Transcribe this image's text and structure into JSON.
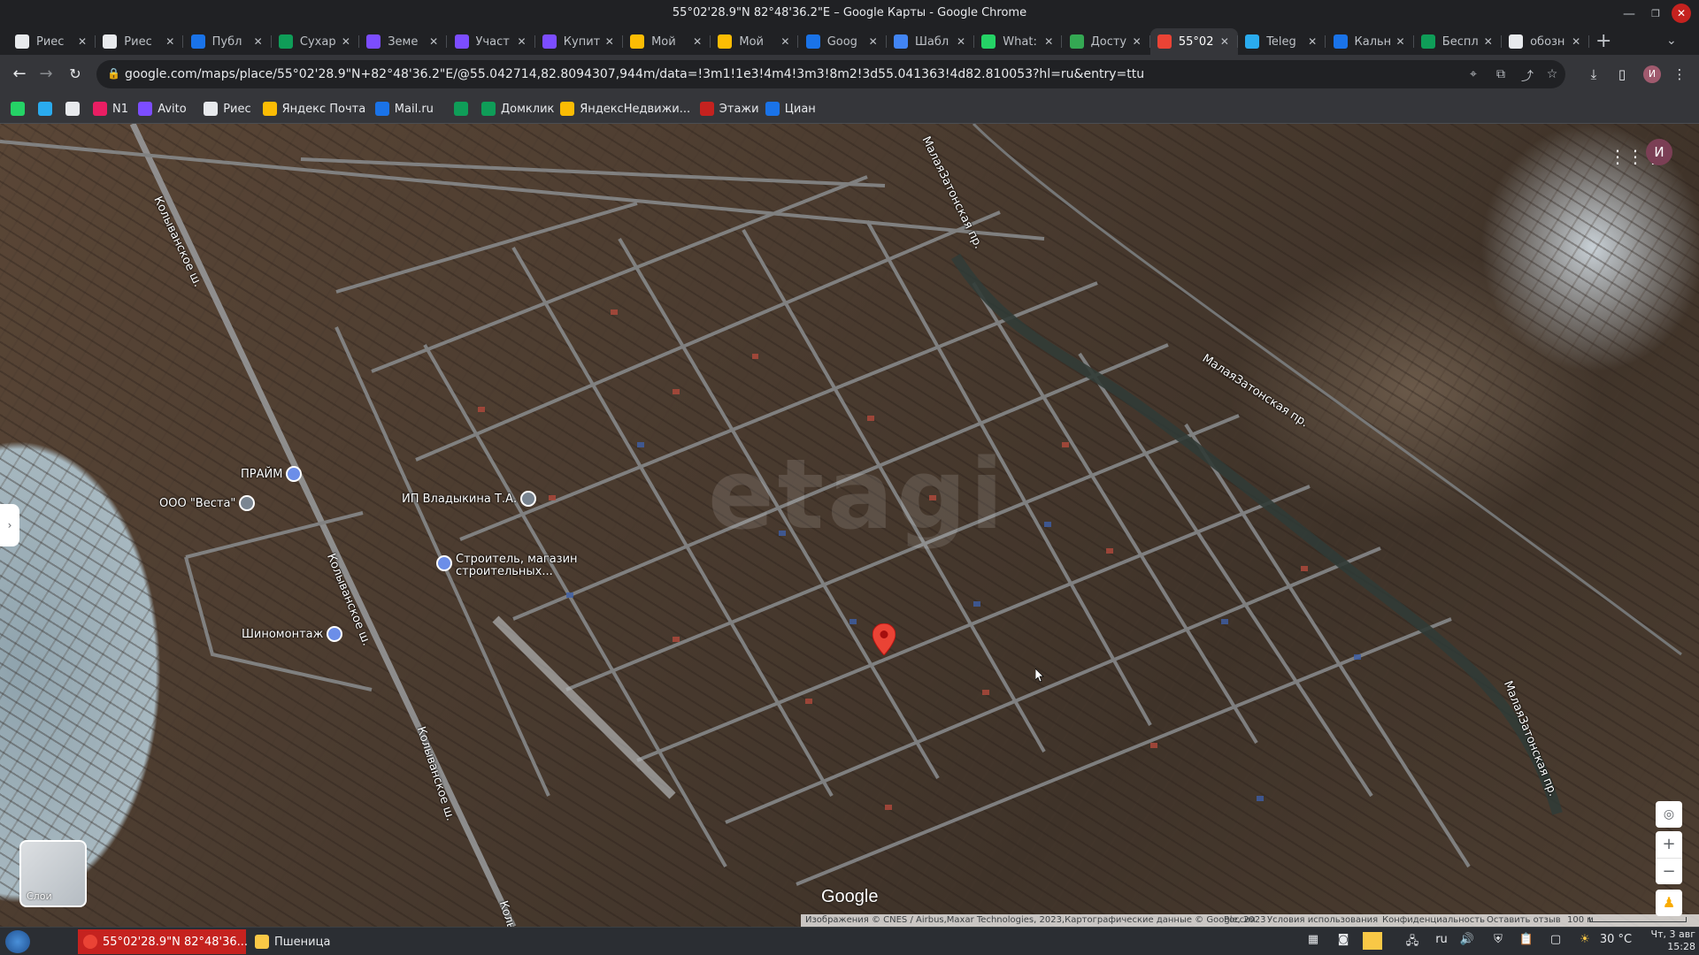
{
  "window": {
    "title": "55°02'28.9\"N 82°48'36.2\"E – Google Карты - Google Chrome"
  },
  "tabs": [
    {
      "label": "Риес",
      "favicon_color": "#e8eaed"
    },
    {
      "label": "Риес",
      "favicon_color": "#e8eaed"
    },
    {
      "label": "Публ",
      "favicon_color": "#1a73e8"
    },
    {
      "label": "Сухар",
      "favicon_color": "#0f9d58"
    },
    {
      "label": "Земе",
      "favicon_color": "#7c4dff"
    },
    {
      "label": "Участ",
      "favicon_color": "#7c4dff"
    },
    {
      "label": "Купит",
      "favicon_color": "#7c4dff"
    },
    {
      "label": "Мой",
      "favicon_color": "#fbbc04"
    },
    {
      "label": "Мой",
      "favicon_color": "#fbbc04"
    },
    {
      "label": "Goog",
      "favicon_color": "#1a73e8"
    },
    {
      "label": "Шабл",
      "favicon_color": "#4285f4"
    },
    {
      "label": "What:",
      "favicon_color": "#25d366"
    },
    {
      "label": "Досту",
      "favicon_color": "#34a853"
    },
    {
      "label": "55°02",
      "favicon_color": "#ea4335",
      "active": true
    },
    {
      "label": "Teleg",
      "favicon_color": "#2aabee"
    },
    {
      "label": "Кальн",
      "favicon_color": "#1a73e8"
    },
    {
      "label": "Беспл",
      "favicon_color": "#0f9d58"
    },
    {
      "label": "обозн",
      "favicon_color": "#e8eaed"
    }
  ],
  "toolbar": {
    "url": "google.com/maps/place/55°02'28.9\"N+82°48'36.2\"E/@55.042714,82.8094307,944m/data=!3m1!1e3!4m4!3m3!8m2!3d55.041363!4d82.810053?hl=ru&entry=ttu",
    "profile_initial": "И"
  },
  "bookmarks": [
    {
      "label": "",
      "icon": "whatsapp-icon",
      "color": "#25d366"
    },
    {
      "label": "",
      "icon": "telegram-icon",
      "color": "#2aabee"
    },
    {
      "label": "",
      "icon": "plus-icon",
      "color": "#e8eaed"
    },
    {
      "label": "N1",
      "icon": "n1-icon",
      "color": "#e91e63"
    },
    {
      "label": "Avito",
      "icon": "avito-icon",
      "color": "#7c4dff"
    },
    {
      "label": "Риес",
      "icon": "ries-icon",
      "color": "#e8eaed"
    },
    {
      "label": "Яндекс Почта",
      "icon": "mail-icon",
      "color": "#fbbc04"
    },
    {
      "label": "Mail.ru",
      "icon": "at-icon",
      "color": "#1a73e8"
    },
    {
      "label": "",
      "icon": "sber-icon",
      "color": "#0f9d58"
    },
    {
      "label": "Домклик",
      "icon": "domclick-icon",
      "color": "#0f9d58"
    },
    {
      "label": "ЯндексНедвижи...",
      "icon": "home-icon",
      "color": "#fbbc04"
    },
    {
      "label": "Этажи",
      "icon": "etazhi-icon",
      "color": "#c5221f"
    },
    {
      "label": "Циан",
      "icon": "cian-icon",
      "color": "#1a73e8"
    }
  ],
  "map": {
    "places": [
      {
        "label": "ПРАЙМ",
        "icon": "bus-icon"
      },
      {
        "label": "ООО \"Веста\"",
        "icon": "place-icon"
      },
      {
        "label": "ИП Владыкина Т.А.",
        "icon": "place-icon"
      },
      {
        "label": "Шиномонтаж",
        "icon": "tire-service-icon"
      },
      {
        "label": "Строитель, магазин строительных...",
        "icon": "store-icon"
      }
    ],
    "road_labels": [
      "МалаяЗатонская пр.",
      "МалаяЗатонская пр.",
      "МалаяЗатонская пр.",
      "Колыванское ш.",
      "Колыванское ш.",
      "Колыванское ш.",
      "Колыванское ш."
    ],
    "watermark": "etagi",
    "layers_label": "Слои",
    "account_initial": "И",
    "google_logo": "Google"
  },
  "attribution": {
    "imagery": "Изображения © CNES / Airbus,Maxar Technologies, 2023,Картографические данные © Google, 2023",
    "region": "Россия",
    "terms": "Условия использования",
    "privacy": "Конфиденциальность",
    "feedback": "Оставить отзыв",
    "scale": "100 м"
  },
  "taskbar": {
    "tasks": [
      {
        "label": "55°02'28.9\"N 82°48'36...",
        "active": true
      },
      {
        "label": "Пшеница",
        "active": false
      }
    ],
    "lang": "ru",
    "temperature": "30 °C",
    "date": "Чт, 3 авг",
    "time": "15:28"
  }
}
